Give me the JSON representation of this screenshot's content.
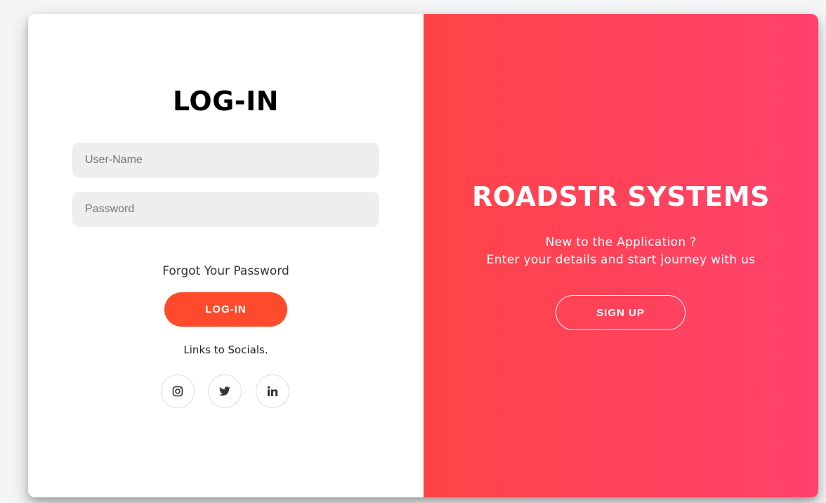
{
  "login": {
    "title": "LOG-IN",
    "username_placeholder": "User-Name",
    "password_placeholder": "Password",
    "forgot_label": "Forgot Your Password",
    "button_label": "LOG-IN",
    "socials_label": "Links to Socials.",
    "socials": [
      {
        "name": "instagram",
        "icon": "instagram-icon"
      },
      {
        "name": "twitter",
        "icon": "twitter-icon"
      },
      {
        "name": "linkedin",
        "icon": "linkedin-icon"
      }
    ]
  },
  "signup": {
    "brand": "ROADSTR SYSTEMS",
    "line1": "New to the Application ?",
    "line2": "Enter your details and start journey with us",
    "button_label": "SIGN UP"
  },
  "colors": {
    "login_button": "#ff4b2b",
    "panel_gradient_start": "#ff4447",
    "panel_gradient_end": "#ff416c",
    "input_bg": "#eeeeee"
  }
}
